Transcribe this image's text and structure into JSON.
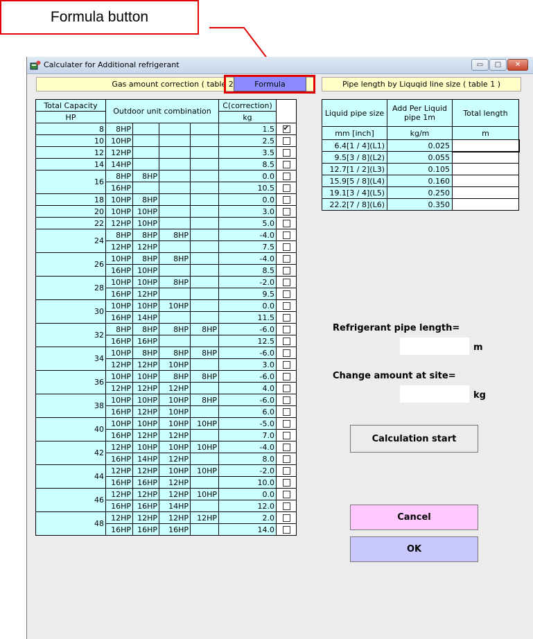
{
  "annotation": {
    "label": "Formula button"
  },
  "window": {
    "title": "Calculater for Additional refrigerant",
    "controls": {
      "minimize": "▭",
      "maximize": "□",
      "close": "✕"
    }
  },
  "header": {
    "gas_table_label": "Gas amount correction ( table 2 )",
    "formula_label": "Formula",
    "pipe_table_label": "Pipe length by Liquqid line size ( table 1 )"
  },
  "table2": {
    "headers": {
      "total_capacity": "Total Capacity",
      "hp": "HP",
      "combination": "Outdoor unit combination",
      "correction": "C(correction)",
      "kg": "kg"
    },
    "rows": [
      {
        "cap": "8",
        "units": [
          "8HP",
          "",
          "",
          ""
        ],
        "c": "1.5",
        "checked": true
      },
      {
        "cap": "10",
        "units": [
          "10HP",
          "",
          "",
          ""
        ],
        "c": "2.5",
        "checked": false
      },
      {
        "cap": "12",
        "units": [
          "12HP",
          "",
          "",
          ""
        ],
        "c": "3.5",
        "checked": false
      },
      {
        "cap": "14",
        "units": [
          "14HP",
          "",
          "",
          ""
        ],
        "c": "8.5",
        "checked": false
      },
      {
        "cap": "16",
        "units": [
          "8HP",
          "8HP",
          "",
          ""
        ],
        "c": "0.0",
        "checked": false
      },
      {
        "cap": "",
        "units": [
          "16HP",
          "",
          "",
          ""
        ],
        "c": "10.5",
        "checked": false
      },
      {
        "cap": "18",
        "units": [
          "10HP",
          "8HP",
          "",
          ""
        ],
        "c": "0.0",
        "checked": false
      },
      {
        "cap": "20",
        "units": [
          "10HP",
          "10HP",
          "",
          ""
        ],
        "c": "3.0",
        "checked": false
      },
      {
        "cap": "22",
        "units": [
          "12HP",
          "10HP",
          "",
          ""
        ],
        "c": "5.0",
        "checked": false
      },
      {
        "cap": "24",
        "units": [
          "8HP",
          "8HP",
          "8HP",
          ""
        ],
        "c": "-4.0",
        "checked": false
      },
      {
        "cap": "",
        "units": [
          "12HP",
          "12HP",
          "",
          ""
        ],
        "c": "7.5",
        "checked": false
      },
      {
        "cap": "26",
        "units": [
          "10HP",
          "8HP",
          "8HP",
          ""
        ],
        "c": "-4.0",
        "checked": false
      },
      {
        "cap": "",
        "units": [
          "16HP",
          "10HP",
          "",
          ""
        ],
        "c": "8.5",
        "checked": false
      },
      {
        "cap": "28",
        "units": [
          "10HP",
          "10HP",
          "8HP",
          ""
        ],
        "c": "-2.0",
        "checked": false
      },
      {
        "cap": "",
        "units": [
          "16HP",
          "12HP",
          "",
          ""
        ],
        "c": "9.5",
        "checked": false
      },
      {
        "cap": "30",
        "units": [
          "10HP",
          "10HP",
          "10HP",
          ""
        ],
        "c": "0.0",
        "checked": false
      },
      {
        "cap": "",
        "units": [
          "16HP",
          "14HP",
          "",
          ""
        ],
        "c": "11.5",
        "checked": false
      },
      {
        "cap": "32",
        "units": [
          "8HP",
          "8HP",
          "8HP",
          "8HP"
        ],
        "c": "-6.0",
        "checked": false
      },
      {
        "cap": "",
        "units": [
          "16HP",
          "16HP",
          "",
          ""
        ],
        "c": "12.5",
        "checked": false
      },
      {
        "cap": "34",
        "units": [
          "10HP",
          "8HP",
          "8HP",
          "8HP"
        ],
        "c": "-6.0",
        "checked": false
      },
      {
        "cap": "",
        "units": [
          "12HP",
          "12HP",
          "10HP",
          ""
        ],
        "c": "3.0",
        "checked": false
      },
      {
        "cap": "36",
        "units": [
          "10HP",
          "10HP",
          "8HP",
          "8HP"
        ],
        "c": "-6.0",
        "checked": false
      },
      {
        "cap": "",
        "units": [
          "12HP",
          "12HP",
          "12HP",
          ""
        ],
        "c": "4.0",
        "checked": false
      },
      {
        "cap": "38",
        "units": [
          "10HP",
          "10HP",
          "10HP",
          "8HP"
        ],
        "c": "-6.0",
        "checked": false
      },
      {
        "cap": "",
        "units": [
          "16HP",
          "12HP",
          "10HP",
          ""
        ],
        "c": "6.0",
        "checked": false
      },
      {
        "cap": "40",
        "units": [
          "10HP",
          "10HP",
          "10HP",
          "10HP"
        ],
        "c": "-5.0",
        "checked": false
      },
      {
        "cap": "",
        "units": [
          "16HP",
          "12HP",
          "12HP",
          ""
        ],
        "c": "7.0",
        "checked": false
      },
      {
        "cap": "42",
        "units": [
          "12HP",
          "10HP",
          "10HP",
          "10HP"
        ],
        "c": "-4.0",
        "checked": false
      },
      {
        "cap": "",
        "units": [
          "16HP",
          "14HP",
          "12HP",
          ""
        ],
        "c": "8.0",
        "checked": false
      },
      {
        "cap": "44",
        "units": [
          "12HP",
          "12HP",
          "10HP",
          "10HP"
        ],
        "c": "-2.0",
        "checked": false
      },
      {
        "cap": "",
        "units": [
          "16HP",
          "16HP",
          "12HP",
          ""
        ],
        "c": "10.0",
        "checked": false
      },
      {
        "cap": "46",
        "units": [
          "12HP",
          "12HP",
          "12HP",
          "10HP"
        ],
        "c": "0.0",
        "checked": false
      },
      {
        "cap": "",
        "units": [
          "16HP",
          "16HP",
          "14HP",
          ""
        ],
        "c": "12.0",
        "checked": false
      },
      {
        "cap": "48",
        "units": [
          "12HP",
          "12HP",
          "12HP",
          "12HP"
        ],
        "c": "2.0",
        "checked": false
      },
      {
        "cap": "",
        "units": [
          "16HP",
          "16HP",
          "16HP",
          ""
        ],
        "c": "14.0",
        "checked": false
      }
    ]
  },
  "table1": {
    "headers": {
      "size": "Liquid pipe size",
      "add": "Add Per Liquid pipe 1m",
      "total": "Total length",
      "size_unit": "mm [inch]",
      "add_unit": "kg/m",
      "total_unit": "m"
    },
    "rows": [
      {
        "size": "6.4[1 / 4](L1)",
        "add": "0.025",
        "total": ""
      },
      {
        "size": "9.5[3 / 8](L2)",
        "add": "0.055",
        "total": ""
      },
      {
        "size": "12.7[1 / 2](L3)",
        "add": "0.105",
        "total": ""
      },
      {
        "size": "15.9[5 / 8](L4)",
        "add": "0.160",
        "total": ""
      },
      {
        "size": "19.1[3 / 4](L5)",
        "add": "0.250",
        "total": ""
      },
      {
        "size": "22.2[7 / 8](L6)",
        "add": "0.350",
        "total": ""
      }
    ]
  },
  "results": {
    "pipe_length_label": "Refrigerant pipe length=",
    "pipe_length_value": "",
    "pipe_length_unit": "m",
    "change_label": "Change amount at site=",
    "change_value": "",
    "change_unit": "kg"
  },
  "buttons": {
    "calc": "Calculation start",
    "cancel": "Cancel",
    "ok": "OK"
  },
  "colors": {
    "callout_red": "#e00000",
    "table_bg": "#ccffff",
    "label_bg": "#ffffc7",
    "formula_bg": "#8b8bff",
    "cancel_bg": "#ffc8ff",
    "ok_bg": "#c8c8ff"
  }
}
